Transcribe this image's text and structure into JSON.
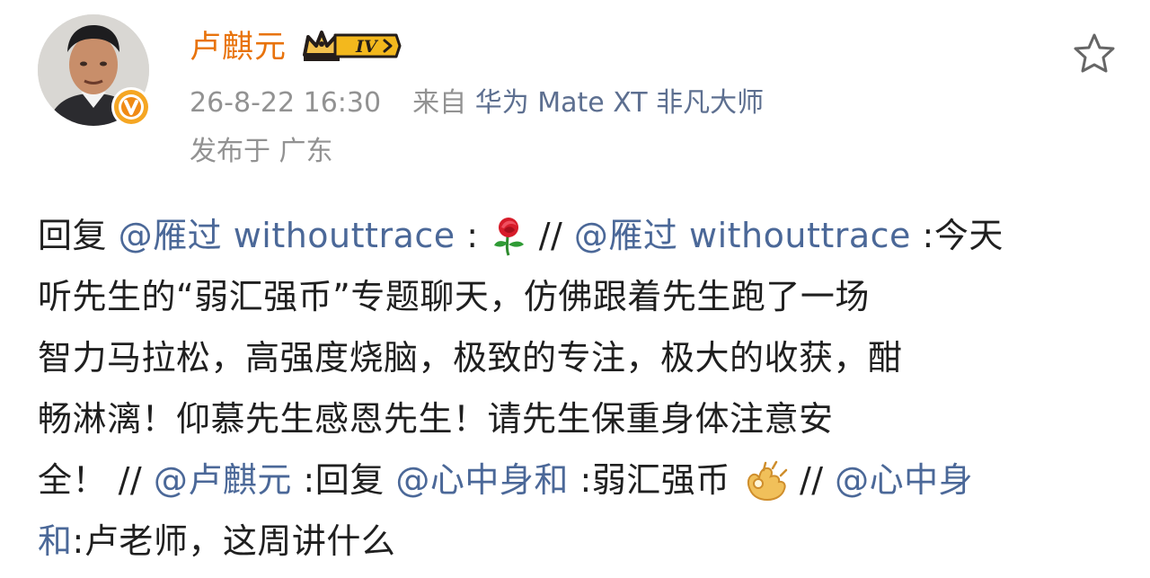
{
  "author": {
    "name": "卢麒元",
    "level_badge": "IV"
  },
  "post_meta": {
    "timestamp": "26-8-22 16:30",
    "source_prefix": "来自",
    "device": "华为 Mate XT 非凡大师",
    "location": "发布于 广东"
  },
  "content": {
    "line1": {
      "part1": "回复",
      "mention1": "@雁过 withouttrace",
      "colon1": ":",
      "slashes1": " //",
      "mention2": "@雁过 withouttrace",
      "text1": ":今天"
    },
    "line2": {
      "text": "听先生的“弱汇强币”专题聊天，仿佛跟着先生跑了一场"
    },
    "line3": {
      "text": "智力马拉松，高强度烧脑，极致的专注，极大的收获，酣"
    },
    "line4": {
      "text": "畅淋漓！仰慕先生感恩先生！请先生保重身体注意安"
    },
    "line5": {
      "text1": "全！",
      "slashes1": "//",
      "mention1": "@卢麒元",
      "text2": ":回复",
      "mention2": "@心中身和",
      "text3": ":弱汇强币",
      "slashes2": "//",
      "mention3": "@心中身"
    },
    "line6": {
      "mention": "和",
      "text": ":卢老师，这周讲什么"
    }
  },
  "emojis": {
    "rose": "rose-emoji",
    "ok_hand": "ok-hand-emoji"
  },
  "colors": {
    "username": "#e8730c",
    "mention": "#4b6898",
    "meta": "#929292",
    "device": "#5d6f90",
    "verified_badge": "#f5a623"
  }
}
